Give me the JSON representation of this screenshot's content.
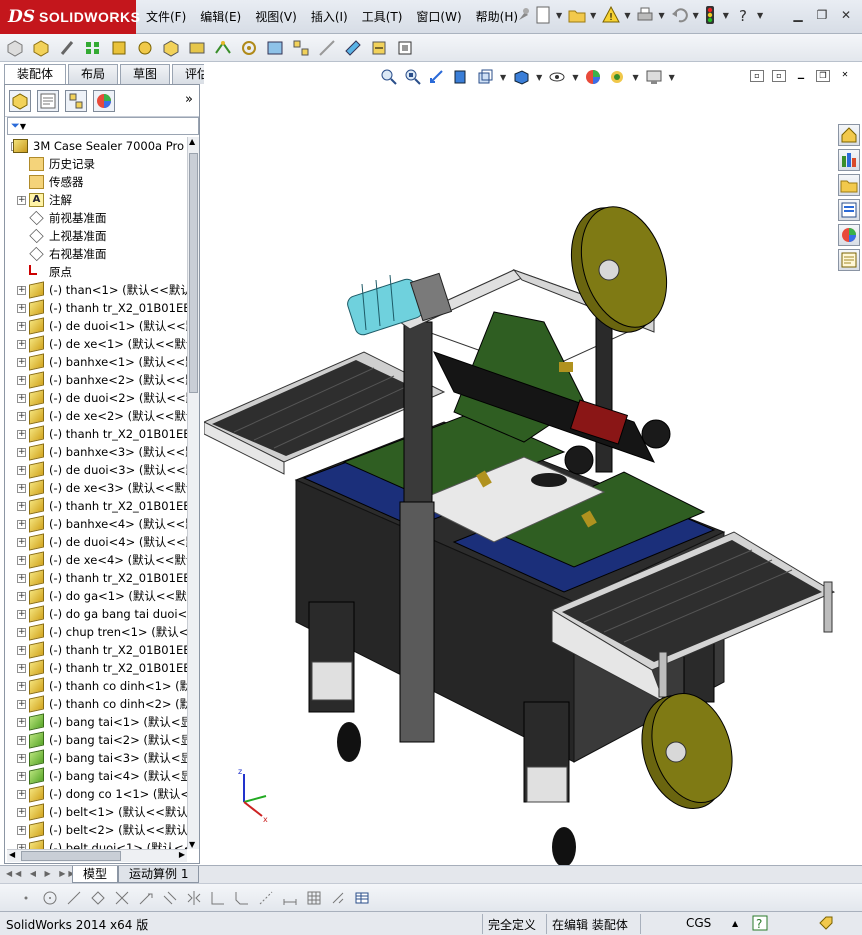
{
  "app": {
    "logo_ds": "DS",
    "logo_name": "SOLIDWORKS"
  },
  "menu": [
    "文件(F)",
    "编辑(E)",
    "视图(V)",
    "插入(I)",
    "工具(T)",
    "窗口(W)",
    "帮助(H)"
  ],
  "panel_tabs": [
    {
      "label": "装配体",
      "active": true
    },
    {
      "label": "布局",
      "active": false
    },
    {
      "label": "草图",
      "active": false
    },
    {
      "label": "评估",
      "active": false
    }
  ],
  "panel": {
    "more_glyph": "»",
    "filter_glyph": "▼"
  },
  "tree": [
    {
      "label": "3M Case Sealer 7000a Pro  (默认<",
      "icon": "asm",
      "indent": 0,
      "expand": "-"
    },
    {
      "label": "历史记录",
      "icon": "folder",
      "indent": 1,
      "expand": ""
    },
    {
      "label": "传感器",
      "icon": "folder",
      "indent": 1,
      "expand": ""
    },
    {
      "label": "注解",
      "icon": "note",
      "indent": 1,
      "expand": "+"
    },
    {
      "label": "前视基准面",
      "icon": "plane",
      "indent": 1,
      "expand": ""
    },
    {
      "label": "上视基准面",
      "icon": "plane",
      "indent": 1,
      "expand": ""
    },
    {
      "label": "右视基准面",
      "icon": "plane",
      "indent": 1,
      "expand": ""
    },
    {
      "label": "原点",
      "icon": "origin",
      "indent": 1,
      "expand": ""
    },
    {
      "label": "(-) than<1> (默认<<默认>_",
      "icon": "part",
      "indent": 1,
      "expand": "+"
    },
    {
      "label": "(-) thanh tr_X2_01B01EE3_X(",
      "icon": "part",
      "indent": 1,
      "expand": "+"
    },
    {
      "label": "(-) de duoi<1> (默认<<默认",
      "icon": "part",
      "indent": 1,
      "expand": "+"
    },
    {
      "label": "(-) de xe<1> (默认<<默认>_",
      "icon": "part",
      "indent": 1,
      "expand": "+"
    },
    {
      "label": "(-) banhxe<1> (默认<<默认",
      "icon": "part",
      "indent": 1,
      "expand": "+"
    },
    {
      "label": "(-) banhxe<2> (默认<<默认",
      "icon": "part",
      "indent": 1,
      "expand": "+"
    },
    {
      "label": "(-) de duoi<2> (默认<<默认",
      "icon": "part",
      "indent": 1,
      "expand": "+"
    },
    {
      "label": "(-) de xe<2> (默认<<默认>_",
      "icon": "part",
      "indent": 1,
      "expand": "+"
    },
    {
      "label": "(-) thanh tr_X2_01B01EE3_X(",
      "icon": "part",
      "indent": 1,
      "expand": "+"
    },
    {
      "label": "(-) banhxe<3> (默认<<默认",
      "icon": "part",
      "indent": 1,
      "expand": "+"
    },
    {
      "label": "(-) de duoi<3> (默认<<默认",
      "icon": "part",
      "indent": 1,
      "expand": "+"
    },
    {
      "label": "(-) de xe<3> (默认<<默认>_",
      "icon": "part",
      "indent": 1,
      "expand": "+"
    },
    {
      "label": "(-) thanh tr_X2_01B01EE3_X(",
      "icon": "part",
      "indent": 1,
      "expand": "+"
    },
    {
      "label": "(-) banhxe<4> (默认<<默认",
      "icon": "part",
      "indent": 1,
      "expand": "+"
    },
    {
      "label": "(-) de duoi<4> (默认<<默认",
      "icon": "part",
      "indent": 1,
      "expand": "+"
    },
    {
      "label": "(-) de xe<4> (默认<<默认>_",
      "icon": "part",
      "indent": 1,
      "expand": "+"
    },
    {
      "label": "(-) thanh tr_X2_01B01EE3_X(",
      "icon": "part",
      "indent": 1,
      "expand": "+"
    },
    {
      "label": "(-) do ga<1> (默认<<默认>_",
      "icon": "part",
      "indent": 1,
      "expand": "+"
    },
    {
      "label": "(-) do ga bang tai duoi<1> (默",
      "icon": "part",
      "indent": 1,
      "expand": "+"
    },
    {
      "label": "(-) chup tren<1> (默认<<默",
      "icon": "part",
      "indent": 1,
      "expand": "+"
    },
    {
      "label": "(-) thanh tr_X2_01B01EE3_X(",
      "icon": "part",
      "indent": 1,
      "expand": "+"
    },
    {
      "label": "(-) thanh tr_X2_01B01EE3_X(",
      "icon": "part",
      "indent": 1,
      "expand": "+"
    },
    {
      "label": "(-) thanh co dinh<1> (默认<",
      "icon": "part",
      "indent": 1,
      "expand": "+"
    },
    {
      "label": "(-) thanh co dinh<2> (默认<",
      "icon": "part",
      "indent": 1,
      "expand": "+"
    },
    {
      "label": "(-) bang tai<1> (默认<显示",
      "icon": "part-green",
      "indent": 1,
      "expand": "+"
    },
    {
      "label": "(-) bang tai<2> (默认<显示",
      "icon": "part-green",
      "indent": 1,
      "expand": "+"
    },
    {
      "label": "(-) bang tai<3> (默认<显示",
      "icon": "part-green",
      "indent": 1,
      "expand": "+"
    },
    {
      "label": "(-) bang tai<4> (默认<显示",
      "icon": "part-green",
      "indent": 1,
      "expand": "+"
    },
    {
      "label": "(-) dong co 1<1> (默认<<默",
      "icon": "part",
      "indent": 1,
      "expand": "+"
    },
    {
      "label": "(-) belt<1> (默认<<默认>_",
      "icon": "part",
      "indent": 1,
      "expand": "+"
    },
    {
      "label": "(-) belt<2> (默认<<默认>_",
      "icon": "part",
      "indent": 1,
      "expand": "+"
    },
    {
      "label": "(-) belt duoi<1> (默认<<默",
      "icon": "part",
      "indent": 1,
      "expand": "+"
    }
  ],
  "bottom_tabs": [
    {
      "label": "模型",
      "active": true
    },
    {
      "label": "运动算例 1",
      "active": false
    }
  ],
  "status": {
    "version": "SolidWorks 2014 x64 版",
    "definition": "完全定义",
    "mode": "在编辑 装配体",
    "units": "CGS"
  },
  "icons": {
    "menu_pin": "pin-icon",
    "quick_access": [
      "new-document-icon",
      "open-icon",
      "rebuild-icon",
      "print-icon",
      "undo-icon",
      "traffic-light-icon",
      "help-icon"
    ],
    "headsup": [
      "zoom-to-fit-icon",
      "zoom-area-icon",
      "previous-view-icon",
      "section-view-icon",
      "view-orientation-icon",
      "display-style-icon",
      "hide-show-icon",
      "edit-appearance-icon",
      "apply-scene-icon",
      "view-settings-icon"
    ],
    "taskpane": [
      "solidworks-resources-icon",
      "design-library-icon",
      "file-explorer-icon",
      "view-palette-icon",
      "appearances-icon",
      "custom-properties-icon"
    ]
  },
  "colors": {
    "brand_red": "#c4161c",
    "conveyor_blue": "#1b2f7a",
    "belt_green": "#2f5e22",
    "tape_roll": "#7f7a14",
    "motor_cyan": "#6fd1dd",
    "frame_black": "#2c2c2c"
  }
}
